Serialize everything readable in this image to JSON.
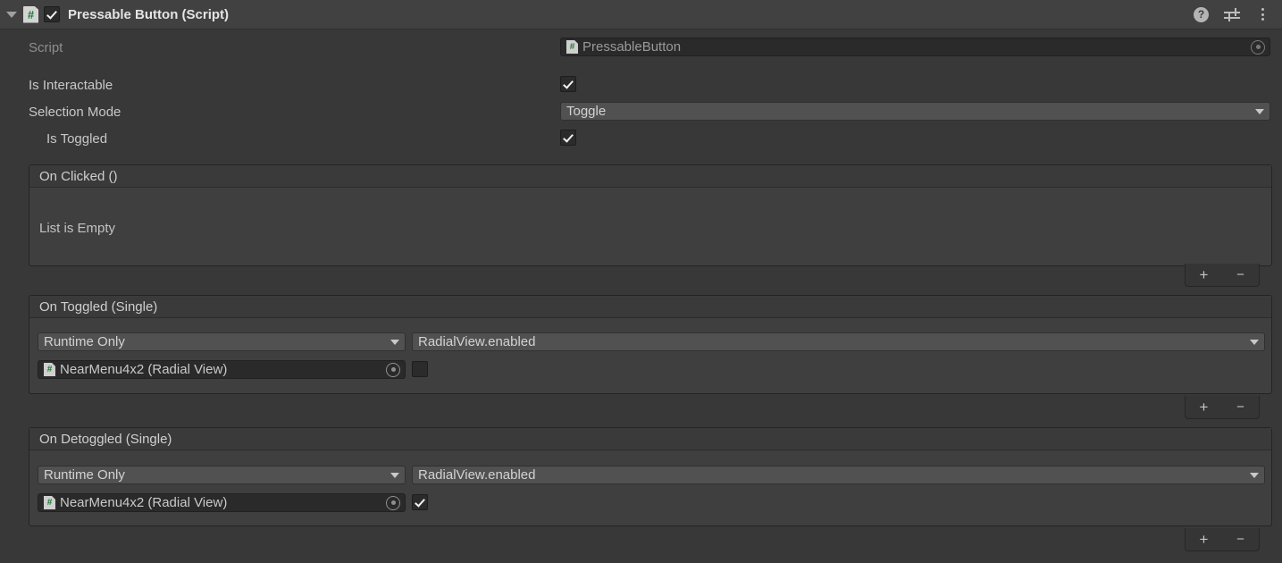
{
  "component": {
    "title": "Pressable Button (Script)",
    "enabled": true,
    "expanded": true,
    "icon": "csharp-script-icon",
    "header_icons": {
      "help": "?",
      "preset": "preset-icon",
      "menu": "kebab-menu-icon"
    }
  },
  "properties": {
    "script": {
      "label": "Script",
      "value": "PressableButton",
      "readonly": true
    },
    "is_interactable": {
      "label": "Is Interactable",
      "value": true
    },
    "selection_mode": {
      "label": "Selection Mode",
      "value": "Toggle",
      "options": [
        "Button",
        "Toggle"
      ]
    },
    "is_toggled": {
      "label": "Is Toggled",
      "value": true
    }
  },
  "events": [
    {
      "header": "On Clicked ()",
      "empty": true,
      "empty_text": "List is Empty",
      "entries": [],
      "add_label": "+",
      "remove_label": "−"
    },
    {
      "header": "On Toggled (Single)",
      "empty": false,
      "empty_text": "",
      "entries": [
        {
          "call_state": "Runtime Only",
          "function": "RadialView.enabled",
          "target_object": "NearMenu4x2 (Radial View)",
          "target_icon": "csharp-script-icon",
          "argument_type": "bool",
          "argument_value": false
        }
      ],
      "add_label": "+",
      "remove_label": "−"
    },
    {
      "header": "On Detoggled (Single)",
      "empty": false,
      "empty_text": "",
      "entries": [
        {
          "call_state": "Runtime Only",
          "function": "RadialView.enabled",
          "target_object": "NearMenu4x2 (Radial View)",
          "target_icon": "csharp-script-icon",
          "argument_type": "bool",
          "argument_value": true
        }
      ],
      "add_label": "+",
      "remove_label": "−"
    }
  ],
  "colors": {
    "background": "#383838",
    "header": "#414141",
    "event_body": "#3f3f3f",
    "dropdown": "#515151",
    "object_field": "#2a2a2a",
    "script_icon_green": "#1d7a33"
  }
}
